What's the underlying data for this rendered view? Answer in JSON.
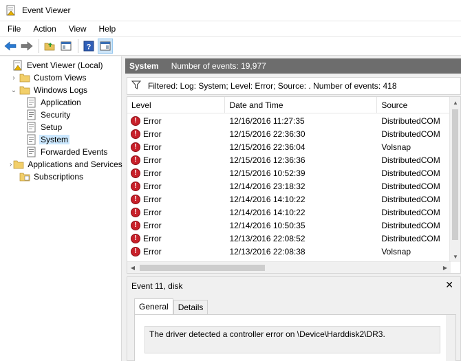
{
  "window": {
    "title": "Event Viewer"
  },
  "menu": [
    "File",
    "Action",
    "View",
    "Help"
  ],
  "tree": [
    {
      "label": "Event Viewer (Local)",
      "icon": "event-viewer-icon",
      "indent": 0,
      "expander": ""
    },
    {
      "label": "Custom Views",
      "icon": "folder-icon",
      "indent": 1,
      "expander": "›"
    },
    {
      "label": "Windows Logs",
      "icon": "folder-icon",
      "indent": 1,
      "expander": "⌄"
    },
    {
      "label": "Application",
      "icon": "log-icon",
      "indent": 2,
      "expander": ""
    },
    {
      "label": "Security",
      "icon": "log-icon",
      "indent": 2,
      "expander": ""
    },
    {
      "label": "Setup",
      "icon": "log-icon",
      "indent": 2,
      "expander": ""
    },
    {
      "label": "System",
      "icon": "log-icon",
      "indent": 2,
      "expander": "",
      "selected": true
    },
    {
      "label": "Forwarded Events",
      "icon": "log-icon",
      "indent": 2,
      "expander": ""
    },
    {
      "label": "Applications and Services Logs",
      "icon": "folder-icon",
      "indent": 1,
      "expander": "›"
    },
    {
      "label": "Subscriptions",
      "icon": "subscriptions-icon",
      "indent": 1,
      "expander": ""
    }
  ],
  "header": {
    "name": "System",
    "count": "Number of events: 19,977"
  },
  "filter": {
    "text": "Filtered: Log: System; Level: Error; Source: . Number of events: 418"
  },
  "columns": {
    "level": "Level",
    "date": "Date and Time",
    "source": "Source"
  },
  "events": [
    {
      "level": "Error",
      "date": "12/16/2016 11:27:35",
      "source": "DistributedCOM"
    },
    {
      "level": "Error",
      "date": "12/15/2016 22:36:30",
      "source": "DistributedCOM"
    },
    {
      "level": "Error",
      "date": "12/15/2016 22:36:04",
      "source": "Volsnap"
    },
    {
      "level": "Error",
      "date": "12/15/2016 12:36:36",
      "source": "DistributedCOM"
    },
    {
      "level": "Error",
      "date": "12/15/2016 10:52:39",
      "source": "DistributedCOM"
    },
    {
      "level": "Error",
      "date": "12/14/2016 23:18:32",
      "source": "DistributedCOM"
    },
    {
      "level": "Error",
      "date": "12/14/2016 14:10:22",
      "source": "DistributedCOM"
    },
    {
      "level": "Error",
      "date": "12/14/2016 14:10:22",
      "source": "DistributedCOM"
    },
    {
      "level": "Error",
      "date": "12/14/2016 10:50:35",
      "source": "DistributedCOM"
    },
    {
      "level": "Error",
      "date": "12/13/2016 22:08:52",
      "source": "DistributedCOM"
    },
    {
      "level": "Error",
      "date": "12/13/2016 22:08:38",
      "source": "Volsnap"
    }
  ],
  "detail": {
    "title": "Event 11, disk",
    "close": "✕",
    "tabs": [
      "General",
      "Details"
    ],
    "message": "The driver detected a controller error on \\Device\\Harddisk2\\DR3."
  },
  "colors": {
    "header_bg": "#6d6d6d",
    "error_red": "#c8202a",
    "selection": "#cce8ff"
  }
}
